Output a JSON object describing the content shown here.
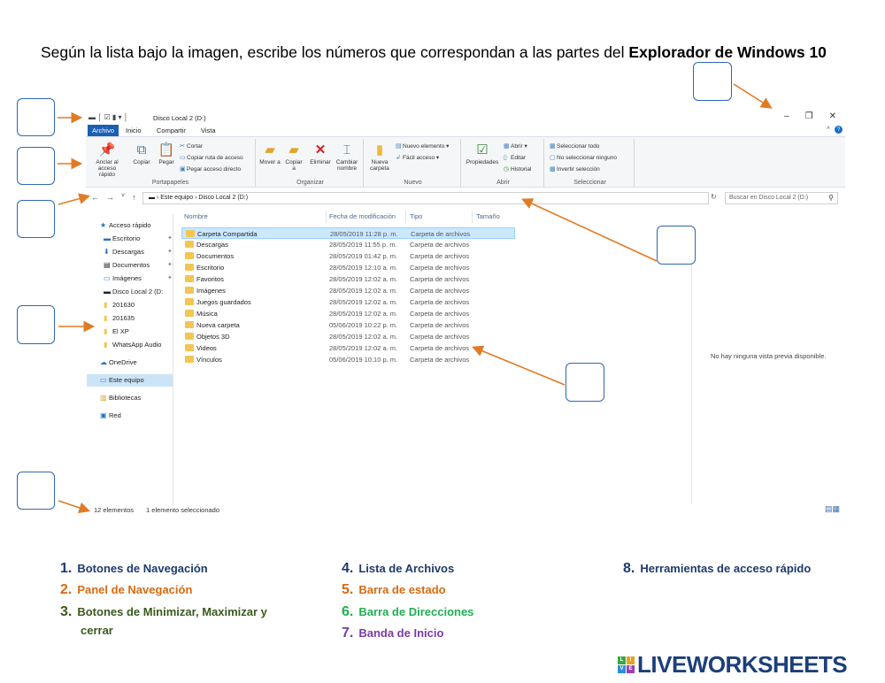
{
  "instructions": {
    "text_before": "Según la lista bajo la imagen, escribe los números que correspondan a las partes del ",
    "text_bold": "Explorador de Windows 10"
  },
  "explorer": {
    "window_title": "Disco Local 2 (D:)",
    "window_controls": {
      "minimize": "–",
      "maximize": "❐",
      "close": "✕"
    },
    "tabs": [
      "Archivo",
      "Inicio",
      "Compartir",
      "Vista"
    ],
    "ribbon": {
      "groups": [
        {
          "label": "Portapapeles",
          "buttons": [
            "Anclar al acceso rápido",
            "Copiar",
            "Pegar"
          ],
          "small": [
            "Cortar",
            "Copiar ruta de acceso",
            "Pegar acceso directo"
          ]
        },
        {
          "label": "Organizar",
          "buttons": [
            "Mover a",
            "Copiar a",
            "Eliminar",
            "Cambiar nombre"
          ]
        },
        {
          "label": "Nuevo",
          "buttons": [
            "Nueva carpeta"
          ],
          "small": [
            "Nuevo elemento ▾",
            "Fácil acceso ▾"
          ]
        },
        {
          "label": "Abrir",
          "buttons": [
            "Propiedades"
          ],
          "small": [
            "Abrir ▾",
            "Editar",
            "Historial"
          ]
        },
        {
          "label": "Seleccionar",
          "small": [
            "Seleccionar todo",
            "No seleccionar ninguno",
            "Invertir selección"
          ]
        }
      ]
    },
    "address": {
      "path": "›  Este equipo  ›  Disco Local 2 (D:)",
      "search_placeholder": "Buscar en Disco Local 2 (D:)"
    },
    "nav_pane": [
      {
        "label": "Acceso rápido",
        "icon": "star-icon"
      },
      {
        "label": "Escritorio",
        "icon": "desktop-icon",
        "pinned": true
      },
      {
        "label": "Descargas",
        "icon": "download-icon",
        "pinned": true
      },
      {
        "label": "Documentos",
        "icon": "document-icon",
        "pinned": true
      },
      {
        "label": "Imágenes",
        "icon": "image-icon",
        "pinned": true
      },
      {
        "label": "Disco Local 2 (D:",
        "icon": "drive-icon",
        "pinned": true
      },
      {
        "label": "201630",
        "icon": "folder-icon"
      },
      {
        "label": "201635",
        "icon": "folder-icon"
      },
      {
        "label": "El XP",
        "icon": "folder-icon"
      },
      {
        "label": "WhatsApp Audio",
        "icon": "folder-icon"
      },
      {
        "label": "OneDrive",
        "icon": "cloud-icon"
      },
      {
        "label": "Este equipo",
        "icon": "computer-icon",
        "selected": true
      },
      {
        "label": "Bibliotecas",
        "icon": "library-icon"
      },
      {
        "label": "Red",
        "icon": "network-icon"
      }
    ],
    "columns": [
      "Nombre",
      "Fecha de modificación",
      "Tipo",
      "Tamaño"
    ],
    "files": [
      {
        "name": "Carpeta Compartida",
        "date": "28/05/2019 11:28 p. m.",
        "type": "Carpeta de archivos",
        "selected": true
      },
      {
        "name": "Descargas",
        "date": "28/05/2019 11:55 p. m.",
        "type": "Carpeta de archivos"
      },
      {
        "name": "Documentos",
        "date": "28/05/2019 01:42 p. m.",
        "type": "Carpeta de archivos"
      },
      {
        "name": "Escritorio",
        "date": "28/05/2019 12:10 a. m.",
        "type": "Carpeta de archivos"
      },
      {
        "name": "Favoritos",
        "date": "28/05/2019 12:02 a. m.",
        "type": "Carpeta de archivos"
      },
      {
        "name": "Imágenes",
        "date": "28/05/2019 12:02 a. m.",
        "type": "Carpeta de archivos"
      },
      {
        "name": "Juegos guardados",
        "date": "28/05/2019 12:02 a. m.",
        "type": "Carpeta de archivos"
      },
      {
        "name": "Música",
        "date": "28/05/2019 12:02 a. m.",
        "type": "Carpeta de archivos"
      },
      {
        "name": "Nueva carpeta",
        "date": "05/06/2019 10:22 p. m.",
        "type": "Carpeta de archivos"
      },
      {
        "name": "Objetos 3D",
        "date": "28/05/2019 12:02 a. m.",
        "type": "Carpeta de archivos"
      },
      {
        "name": "Videos",
        "date": "28/05/2019 12:02 a. m.",
        "type": "Carpeta de archivos"
      },
      {
        "name": "Vínculos",
        "date": "05/06/2019 10:10 p. m.",
        "type": "Carpeta de archivos"
      }
    ],
    "preview_text": "No hay ninguna vista previa disponible.",
    "status": {
      "count": "12 elementos",
      "selected": "1 elemento seleccionado"
    }
  },
  "legend": [
    {
      "num": "1.",
      "text": "Botones de Navegación",
      "color": "#1e3a6e"
    },
    {
      "num": "2.",
      "text": "Panel de Navegación",
      "color": "#d86a10"
    },
    {
      "num": "3.",
      "text": "Botones de Minimizar, Maximizar y",
      "text2": "cerrar",
      "color": "#3a5a1c"
    },
    {
      "num": "4.",
      "text": "Lista de Archivos",
      "color": "#1e3a6e"
    },
    {
      "num": "5.",
      "text": "Barra de estado",
      "color": "#d86a10"
    },
    {
      "num": "6.",
      "text": "Barra de Direcciones",
      "color": "#20b050"
    },
    {
      "num": "7.",
      "text": "Banda de Inicio",
      "color": "#7a3aa8"
    },
    {
      "num": "8.",
      "text": "Herramientas de acceso rápido",
      "color": "#1e3a6e"
    }
  ],
  "brand": {
    "word": "LIVEWORKSHEETS",
    "logo_letters": [
      "L",
      "I",
      "V",
      "E"
    ],
    "logo_colors": [
      "#39a845",
      "#e8a21b",
      "#2c8fd6",
      "#9b3fb5"
    ]
  },
  "colors": {
    "arrow": "#e07b25",
    "box_border": "#2f67b2"
  }
}
